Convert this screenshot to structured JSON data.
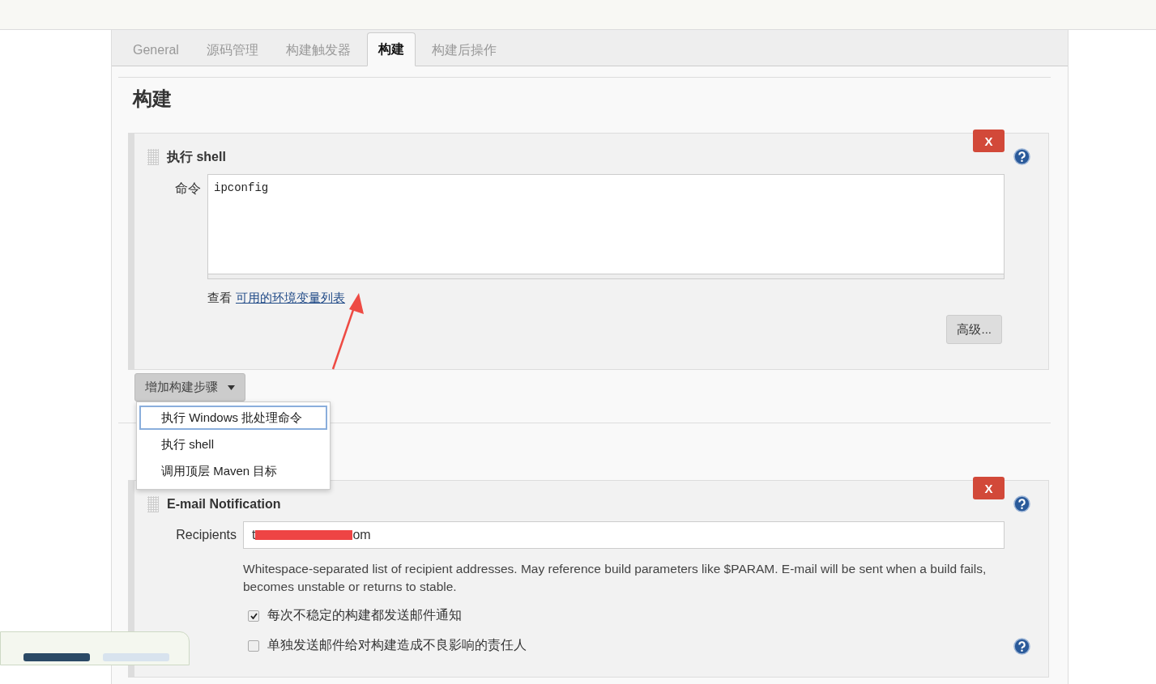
{
  "tabs": [
    {
      "label": "General",
      "selected": false
    },
    {
      "label": "源码管理",
      "selected": false
    },
    {
      "label": "构建触发器",
      "selected": false
    },
    {
      "label": "构建",
      "selected": true
    },
    {
      "label": "构建后操作",
      "selected": false
    }
  ],
  "section_title": "构建",
  "build_step": {
    "title": "执行 shell",
    "delete_label": "X",
    "command_label": "命令",
    "command": "ipconfig",
    "env_prefix": "查看",
    "env_link": "可用的环境变量列表",
    "advanced_button": "高级..."
  },
  "add_step_button": "增加构建步骤",
  "add_step_menu": [
    {
      "label": "执行 Windows 批处理命令",
      "selected": true
    },
    {
      "label": "执行 shell",
      "selected": false
    },
    {
      "label": "调用顶层 Maven 目标",
      "selected": false
    }
  ],
  "email": {
    "title": "E-mail Notification",
    "delete_label": "X",
    "recipients_label": "Recipients",
    "value_start": "t",
    "value_end": "om",
    "redacted": true,
    "help_text": "Whitespace-separated list of recipient addresses. May reference build parameters like $PARAM. E-mail will be sent when a build fails, becomes unstable or returns to stable.",
    "options": [
      {
        "label": "每次不稳定的构建都发送邮件通知",
        "checked": true
      },
      {
        "label": "单独发送邮件给对构建造成不良影响的责任人",
        "checked": false
      }
    ]
  }
}
